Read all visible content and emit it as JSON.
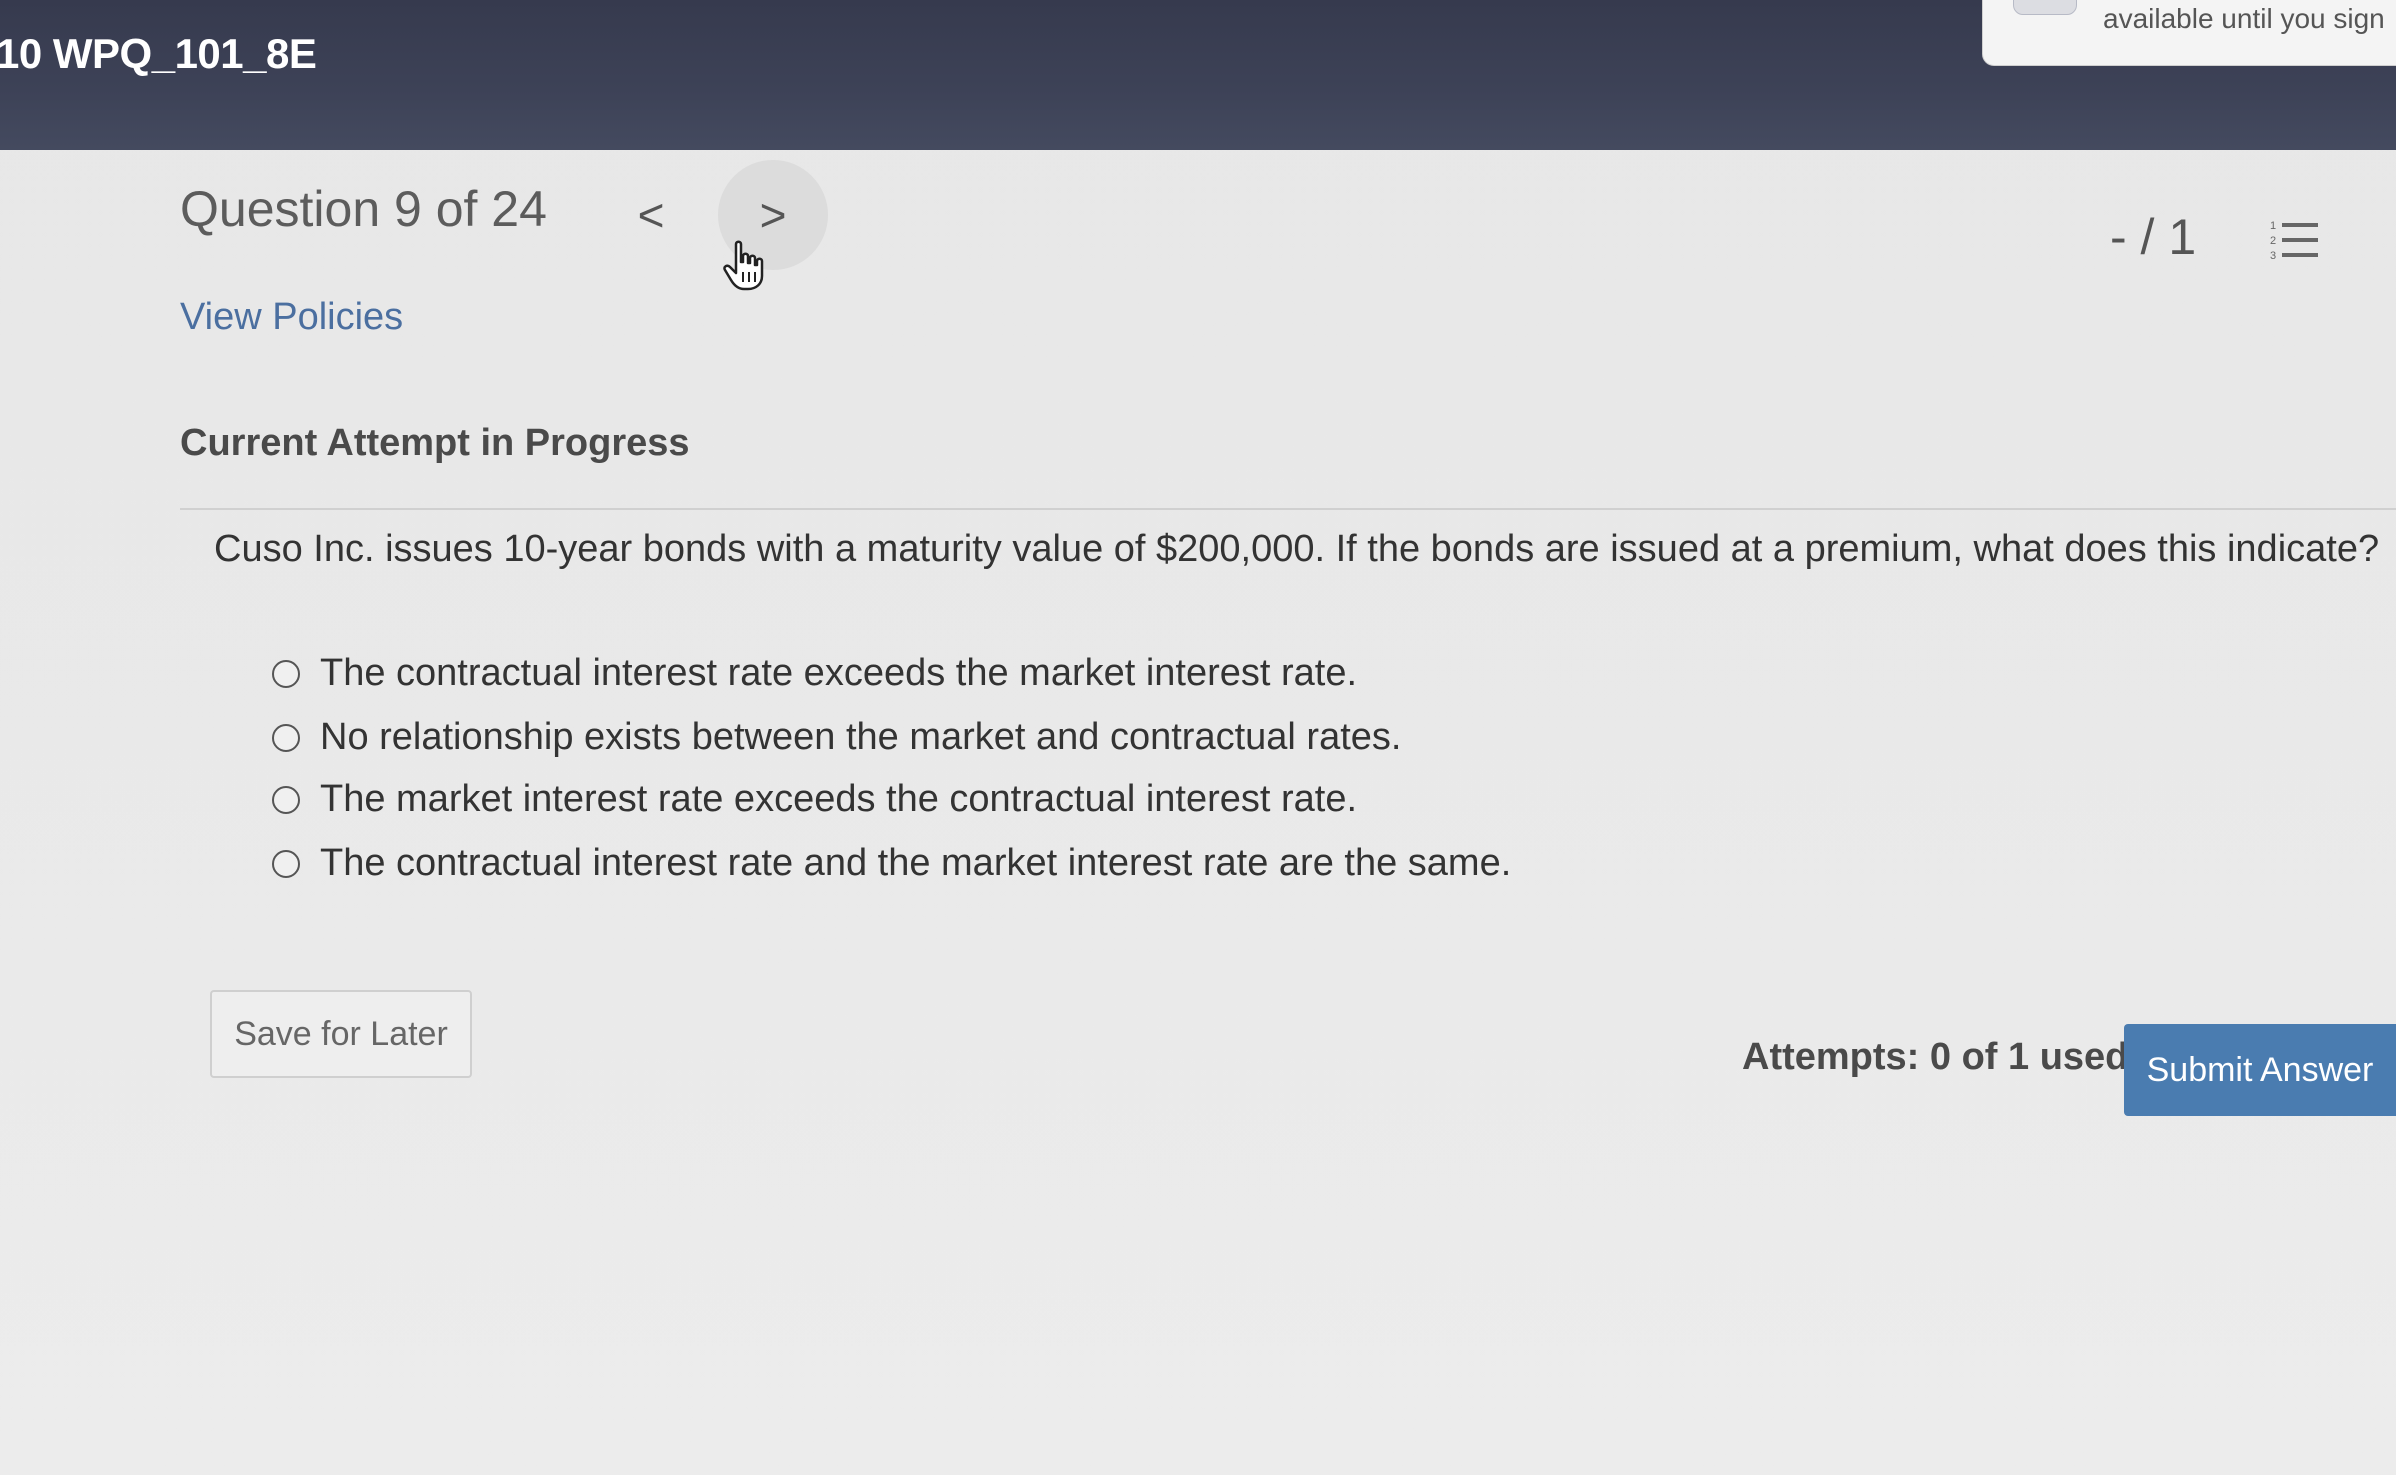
{
  "header": {
    "course_title": "10 WPQ_101_8E",
    "notice_text": "available until you sign"
  },
  "question_nav": {
    "counter": "Question 9 of 24",
    "prev_symbol": "<",
    "next_symbol": ">",
    "score": "- / 1"
  },
  "links": {
    "view_policies": "View Policies"
  },
  "attempt": {
    "heading": "Current Attempt in Progress"
  },
  "question": {
    "text": "Cuso Inc. issues 10-year bonds with a maturity value of $200,000. If the bonds are issued at a premium, what does this indicate?",
    "options": [
      "The contractual interest rate exceeds the market interest rate.",
      "No relationship exists between the market and contractual rates.",
      "The market interest rate exceeds the contractual interest rate.",
      "The contractual interest rate and the market interest rate are the same."
    ]
  },
  "footer": {
    "save_label": "Save for Later",
    "attempts_text": "Attempts: 0 of 1 used",
    "submit_label": "Submit Answer"
  },
  "icons": {
    "pointer": "hand-pointer-icon",
    "list": "numbered-list-icon"
  },
  "colors": {
    "header_bg": "#3d4257",
    "link": "#4b6fa0",
    "submit_bg": "#4a7cb0"
  }
}
